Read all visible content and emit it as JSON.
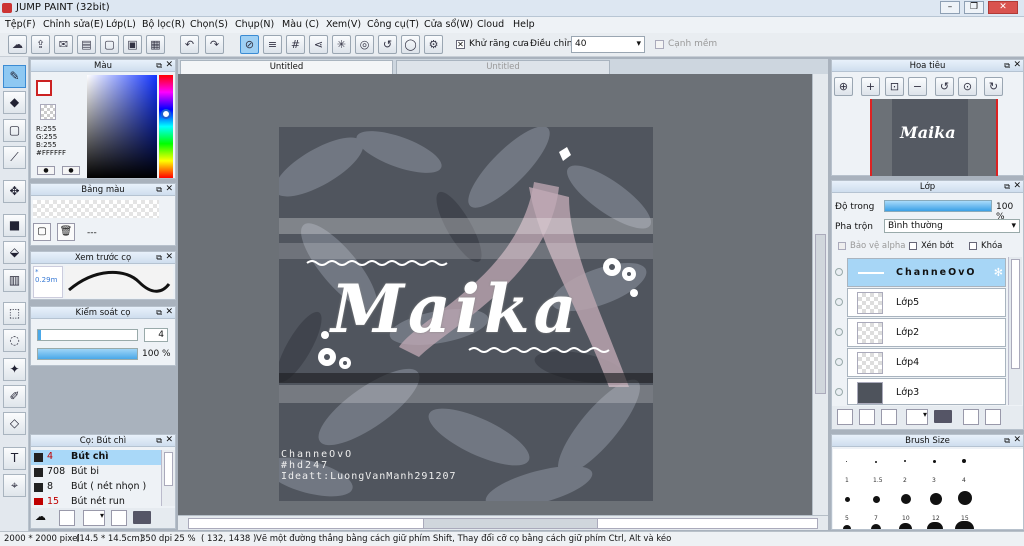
{
  "title": "JUMP PAINT (32bit)",
  "menu": [
    "Tệp(F)",
    "Chỉnh sửa(E)",
    "Lớp(L)",
    "Bộ lọc(R)",
    "Chọn(S)",
    "Chụp(N)",
    "Màu (C)",
    "Xem(V)",
    "Công cụ(T)",
    "Cửa sổ(W)",
    "Cloud",
    "Help"
  ],
  "toolbar": {
    "antialias_label": "Khử răng cưa",
    "adjust_label": "Điều chỉnh",
    "adjust_value": "40",
    "edge_label": "Cạnh mềm"
  },
  "color_panel": {
    "title": "Màu",
    "r": "R:255",
    "g": "G:255",
    "b": "B:255",
    "hex": "#FFFFFF"
  },
  "palette_panel": {
    "title": "Bảng màu",
    "value": "---"
  },
  "brush_preview": {
    "title": "Xem trước cọ",
    "size": "* 0.29m"
  },
  "brush_control": {
    "title": "Kiểm soát cọ",
    "size": "4",
    "opacity": "100 %"
  },
  "pen_list": {
    "title": "Cọ: Bút chì",
    "items": [
      {
        "num": "4",
        "name": "Bút chì",
        "color": "#c00000",
        "selected": true
      },
      {
        "num": "708",
        "name": "Bút bi",
        "color": "#111111"
      },
      {
        "num": "8",
        "name": "Bút ( nét nhọn )",
        "color": "#111111"
      },
      {
        "num": "15",
        "name": "Bút nét run",
        "color": "#c00000"
      }
    ]
  },
  "tabs": [
    "Untitled",
    "Untitled"
  ],
  "artwork": {
    "title": "Maika",
    "signature": "ChanneOvO",
    "tag": "#hd247",
    "credit": "Ideatt:LuongVanManh291207"
  },
  "navigator": {
    "title": "Hoa tiêu"
  },
  "layers": {
    "title": "Lớp",
    "opacity_label": "Độ trong",
    "opacity_value": "100 %",
    "opacity": 1.0,
    "blend_label": "Pha trộn",
    "blend_value": "Bình thường",
    "protect_alpha": "Bảo vệ alpha",
    "clip": "Xén bớt",
    "lock": "Khóa",
    "items": [
      "ChanneOvO",
      "Lớp5",
      "Lớp2",
      "Lớp4",
      "Lớp3"
    ]
  },
  "brush_size": {
    "title": "Brush Size",
    "row1": [
      "1",
      "1.5",
      "2",
      "3",
      "4"
    ],
    "row2": [
      "5",
      "7",
      "10",
      "12",
      "15"
    ]
  },
  "status": {
    "dims": "2000 * 2000 pixel",
    "size_cm": "(14.5 * 14.5cm)",
    "dpi": "350 dpi",
    "zoom": "25 %",
    "coords": "( 132, 1438 )",
    "hint": "Vẽ một đường thẳng bằng cách giữ phím Shift, Thay đổi cỡ cọ bằng cách giữ phím Ctrl, Alt và kéo"
  }
}
